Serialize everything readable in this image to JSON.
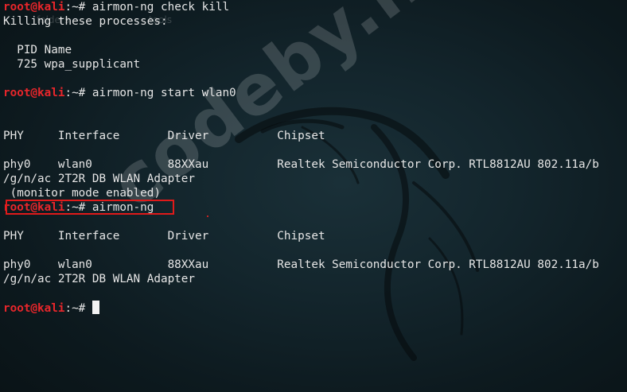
{
  "desktop": {
    "labels": [
      "folders",
      "tools"
    ]
  },
  "watermark": "codeby.net",
  "prompt": {
    "user_host": "root@kali",
    "path": ":~# "
  },
  "lines": [
    {
      "type": "prompt",
      "cmd": "airmon-ng check kill"
    },
    {
      "type": "text",
      "text": "Killing these processes:"
    },
    {
      "type": "text",
      "text": ""
    },
    {
      "type": "text",
      "text": "  PID Name"
    },
    {
      "type": "text",
      "text": "  725 wpa_supplicant"
    },
    {
      "type": "text",
      "text": ""
    },
    {
      "type": "prompt",
      "cmd": "airmon-ng start wlan0"
    },
    {
      "type": "text",
      "text": ""
    },
    {
      "type": "text",
      "text": ""
    },
    {
      "type": "text",
      "text": "PHY     Interface       Driver          Chipset"
    },
    {
      "type": "text",
      "text": ""
    },
    {
      "type": "text",
      "text": "phy0    wlan0           88XXau          Realtek Semiconductor Corp. RTL8812AU 802.11a/b"
    },
    {
      "type": "text",
      "text": "/g/n/ac 2T2R DB WLAN Adapter"
    },
    {
      "type": "text",
      "text": " (monitor mode enabled)"
    },
    {
      "type": "prompt",
      "cmd": "airmon-ng"
    },
    {
      "type": "text",
      "text": ""
    },
    {
      "type": "text",
      "text": "PHY     Interface       Driver          Chipset"
    },
    {
      "type": "text",
      "text": ""
    },
    {
      "type": "text",
      "text": "phy0    wlan0           88XXau          Realtek Semiconductor Corp. RTL8812AU 802.11a/b"
    },
    {
      "type": "text",
      "text": "/g/n/ac 2T2R DB WLAN Adapter"
    },
    {
      "type": "text",
      "text": ""
    },
    {
      "type": "prompt",
      "cmd": "",
      "cursor": true
    }
  ],
  "colors": {
    "prompt_user": "#e8262b",
    "highlight_box": "#e01a1a",
    "text": "#e6e6e6",
    "background": "#13252c"
  }
}
